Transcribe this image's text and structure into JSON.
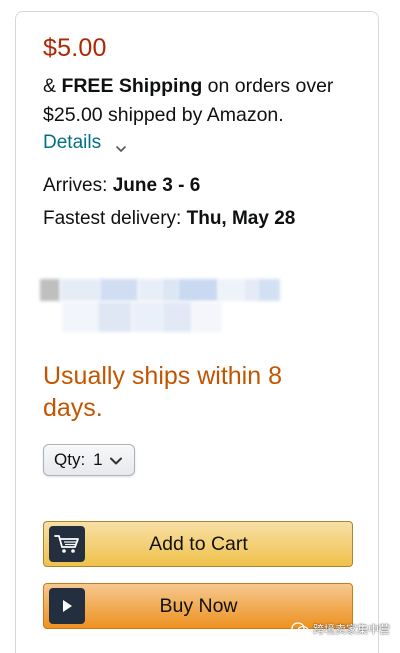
{
  "price": "$5.00",
  "shipping": {
    "prefix": "& ",
    "bold": "FREE Shipping",
    "rest": " on orders over $25.00 shipped by Amazon."
  },
  "details": {
    "label": "Details",
    "icon": "chevron-down-icon"
  },
  "arrives": {
    "label": "Arrives: ",
    "value": "June 3 - 6"
  },
  "fastest": {
    "label": "Fastest delivery: ",
    "value": "Thu, May 28"
  },
  "availability": "Usually ships within 8 days.",
  "quantity": {
    "label": "Qty:",
    "value": "1",
    "icon": "chevron-down-icon"
  },
  "buttons": {
    "add_to_cart": "Add to Cart",
    "buy_now": "Buy Now"
  },
  "watermark": "跨境卖家集中营",
  "colors": {
    "price": "#b12704",
    "link": "#007185",
    "availability": "#c45500",
    "add_to_cart_bg": "#f0c14b",
    "buy_now_bg": "#ed9220",
    "icon_tile": "#232f3e"
  }
}
